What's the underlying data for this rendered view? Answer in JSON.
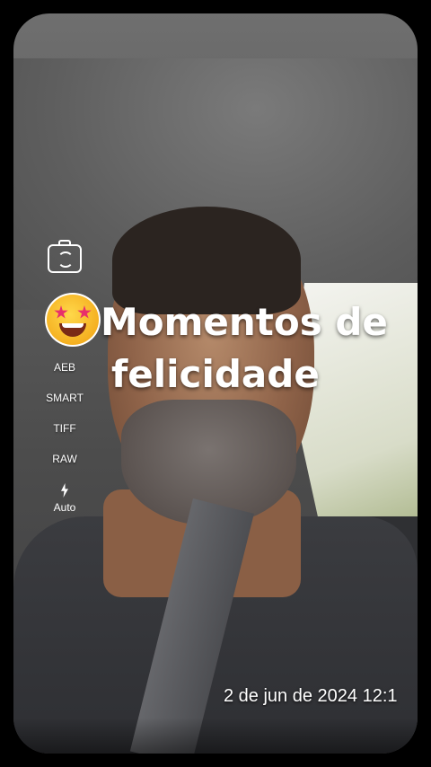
{
  "camera_controls": {
    "switch_icon": "camera-switch-icon",
    "items": [
      "AEB",
      "SMART",
      "TIFF",
      "RAW"
    ],
    "flash": {
      "icon": "flash-bolt-icon",
      "label": "Auto"
    }
  },
  "overlay": {
    "emoji_icon": "star-struck-emoji-icon",
    "caption_line1": "Momentos de",
    "caption_line2": "felicidade"
  },
  "timestamp": "2 de jun de 2024 12:1"
}
